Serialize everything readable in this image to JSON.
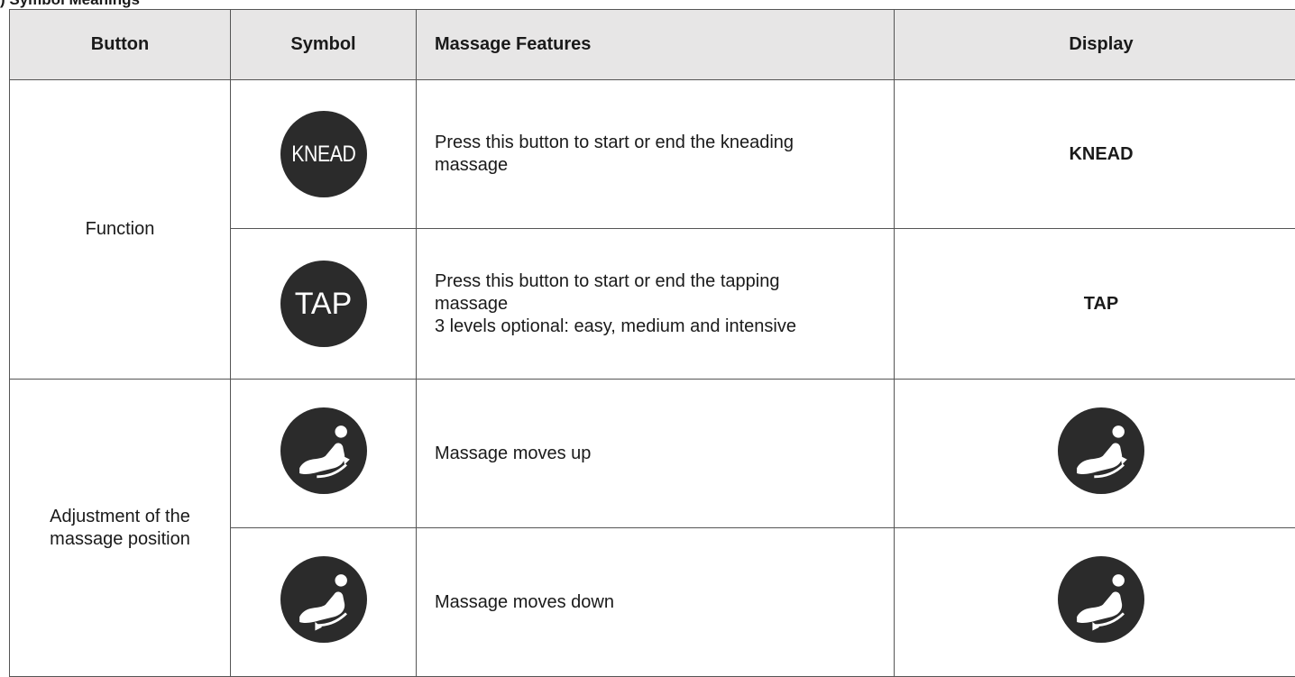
{
  "caption": "Symbol Meanings",
  "table": {
    "headers": [
      "Button",
      "Symbol",
      "Massage Features",
      "Display"
    ],
    "groups": [
      {
        "button": "Function",
        "rows": [
          {
            "symbol_text": "KNEAD",
            "features": [
              "Press this button to start or end the kneading",
              "massage"
            ],
            "display": "KNEAD"
          },
          {
            "symbol_text": "TAP",
            "features": [
              "Press this button to start or end the tapping",
              "massage",
              "3 levels optional: easy, medium and intensive"
            ],
            "display": "TAP"
          }
        ]
      },
      {
        "button_lines": [
          "Adjustment of the",
          "massage position"
        ],
        "rows": [
          {
            "symbol_icon": "chair-arrow-up-icon",
            "features": [
              "Massage moves up"
            ],
            "display_icon": "chair-arrow-up-icon"
          },
          {
            "symbol_icon": "chair-arrow-down-icon",
            "features": [
              "Massage moves down"
            ],
            "display_icon": "chair-arrow-down-icon"
          }
        ]
      }
    ]
  },
  "colors": {
    "header_bg": "#e7e6e6",
    "icon_circle": "#2b2b2b",
    "icon_glyph": "#ffffff"
  }
}
